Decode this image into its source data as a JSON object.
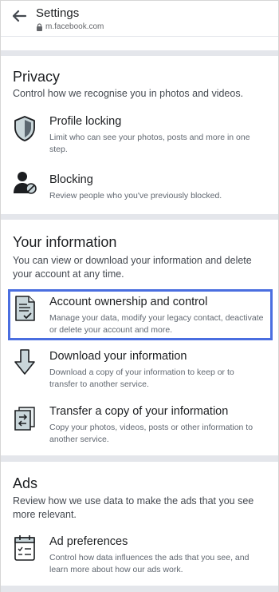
{
  "header": {
    "title": "Settings",
    "url": "m.facebook.com"
  },
  "privacy": {
    "title": "Privacy",
    "description": "Control how we recognise you in photos and videos.",
    "items": [
      {
        "title": "Profile locking",
        "description": "Limit who can see your photos, posts and more in one step.",
        "icon": "shield-icon"
      },
      {
        "title": "Blocking",
        "description": "Review people who you've previously blocked.",
        "icon": "blocked-person-icon"
      }
    ]
  },
  "your_information": {
    "title": "Your information",
    "description": "You can view or download your information and delete your account at any time.",
    "items": [
      {
        "title": "Account ownership and control",
        "description": "Manage your data, modify your legacy contact, deactivate or delete your account and more.",
        "icon": "document-check-icon"
      },
      {
        "title": "Download your information",
        "description": "Download a copy of your information to keep or to transfer to another service.",
        "icon": "download-arrow-icon"
      },
      {
        "title": "Transfer a copy of your information",
        "description": "Copy your photos, videos, posts or other information to another service.",
        "icon": "transfer-icon"
      }
    ]
  },
  "ads": {
    "title": "Ads",
    "description": "Review how we use data to make the ads that you see more relevant.",
    "items": [
      {
        "title": "Ad preferences",
        "description": "Control how data influences the ads that you see, and learn more about how our ads work.",
        "icon": "calendar-list-icon"
      }
    ]
  },
  "colors": {
    "highlight": "#4a6ee0",
    "separator": "#e4e6eb",
    "icon_fill": "#c9d6da",
    "icon_stroke": "#1c1e21"
  }
}
